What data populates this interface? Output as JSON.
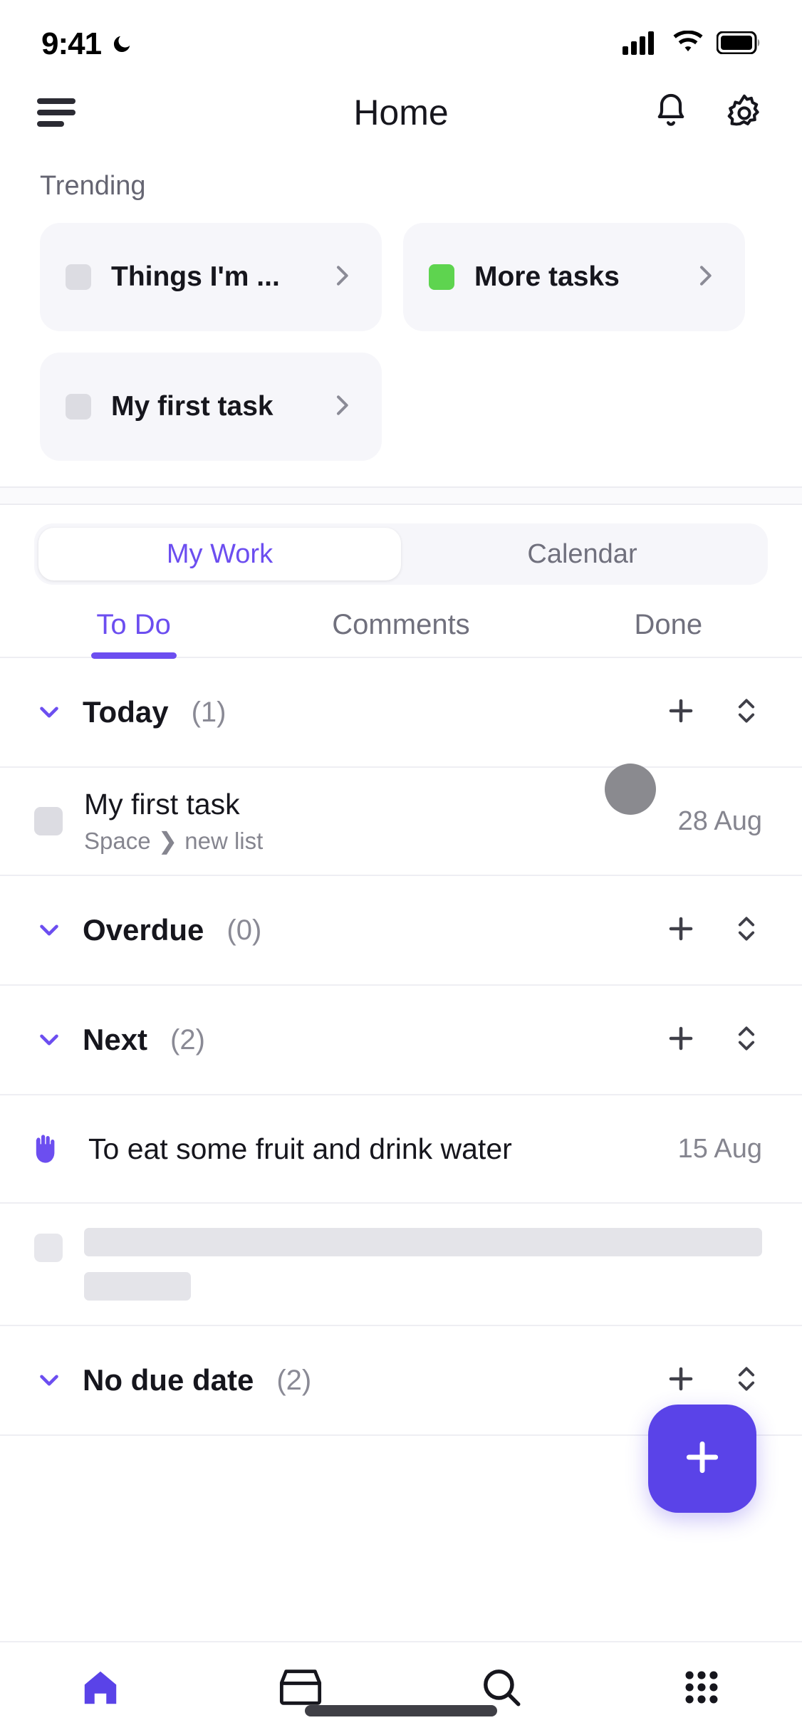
{
  "status_bar": {
    "time": "9:41",
    "dnd_icon": "moon-icon",
    "signal_icon": "cellular-bars-icon",
    "wifi_icon": "wifi-icon",
    "battery_icon": "battery-full-icon"
  },
  "header": {
    "menu_icon": "hamburger-menu-icon",
    "title": "Home",
    "notifications_icon": "bell-icon",
    "settings_icon": "gear-icon"
  },
  "trending": {
    "label": "Trending",
    "cards": [
      {
        "title": "Things I'm ...",
        "badge_color": "#dcdce2",
        "chevron_icon": "chevron-right-icon"
      },
      {
        "title": "More tasks",
        "badge_color": "#5ed44f",
        "chevron_icon": "chevron-right-icon"
      },
      {
        "title": "My first task",
        "badge_color": "#dcdce2",
        "chevron_icon": "chevron-right-icon"
      }
    ]
  },
  "segmented": {
    "options": [
      "My Work",
      "Calendar"
    ],
    "selected": "My Work"
  },
  "tabs": {
    "items": [
      "To Do",
      "Comments",
      "Done"
    ],
    "selected": "To Do"
  },
  "list": {
    "groups": [
      {
        "name": "Today",
        "count": "(1)",
        "collapse_icon": "chevron-down-icon",
        "add_icon": "plus-icon",
        "sort_icon": "sort-updown-icon",
        "tasks": [
          {
            "type": "task",
            "title": "My first task",
            "breadcrumb_space": "Space",
            "breadcrumb_sep": "❯",
            "breadcrumb_list": "new list",
            "date": "28 Aug",
            "status_color": "#dcdce2"
          }
        ]
      },
      {
        "name": "Overdue",
        "count": "(0)",
        "collapse_icon": "chevron-down-icon",
        "add_icon": "plus-icon",
        "sort_icon": "sort-updown-icon",
        "tasks": []
      },
      {
        "name": "Next",
        "count": "(2)",
        "collapse_icon": "chevron-down-icon",
        "add_icon": "plus-icon",
        "sort_icon": "sort-updown-icon",
        "tasks": [
          {
            "type": "recurring",
            "title": "To eat some fruit and drink water",
            "date": "15 Aug",
            "recur_icon": "recurring-hand-icon",
            "recur_color": "#6c4ef0"
          },
          {
            "type": "skeleton",
            "status_color": "#e7e7ec"
          }
        ]
      },
      {
        "name": "No due date",
        "count": "(2)",
        "collapse_icon": "chevron-down-icon",
        "add_icon": "plus-icon",
        "sort_icon": "sort-updown-icon",
        "tasks": []
      }
    ]
  },
  "fab": {
    "icon": "plus-icon",
    "color": "#5a43e8"
  },
  "bottom_nav": {
    "items": [
      {
        "icon": "home-icon",
        "active": true
      },
      {
        "icon": "inbox-icon",
        "active": false
      },
      {
        "icon": "search-icon",
        "active": false
      },
      {
        "icon": "apps-grid-icon",
        "active": false
      }
    ],
    "active_color": "#5a43e8",
    "inactive_color": "#16161d"
  },
  "cursor": {
    "icon": "cursor-blob"
  },
  "theme": {
    "accent": "#6c4ef0",
    "fab": "#5a43e8",
    "surface": "#f6f6fa",
    "text": "#16161d",
    "muted": "#85858f"
  }
}
